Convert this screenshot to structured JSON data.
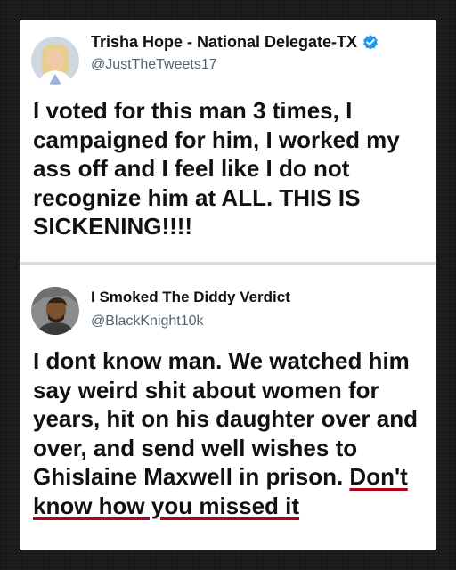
{
  "posts": [
    {
      "display_name": "Trisha Hope - National Delegate-TX",
      "handle": "@JustTheTweets17",
      "verified": true,
      "avatar_icon": "profile-photo",
      "text": "I voted for this man 3 times, I campaigned for him, I worked my ass off and I feel like I do not recognize him at ALL. THIS IS SICKENING!!!!"
    },
    {
      "display_name": "I Smoked The Diddy Verdict",
      "handle": "@BlackKnight10k",
      "verified": false,
      "avatar_icon": "profile-photo",
      "text": "I dont know man. We watched him say weird shit about women for years, hit on his daughter over and over, and send well wishes to Ghislaine Maxwell in prison. ",
      "underlined_text": "Don't know how you missed it",
      "underline_color": "#b3001b"
    }
  ],
  "colors": {
    "verified_badge": "#1d9bf0",
    "handle": "#536471",
    "text": "#111111",
    "background": "#1b1b1b"
  }
}
